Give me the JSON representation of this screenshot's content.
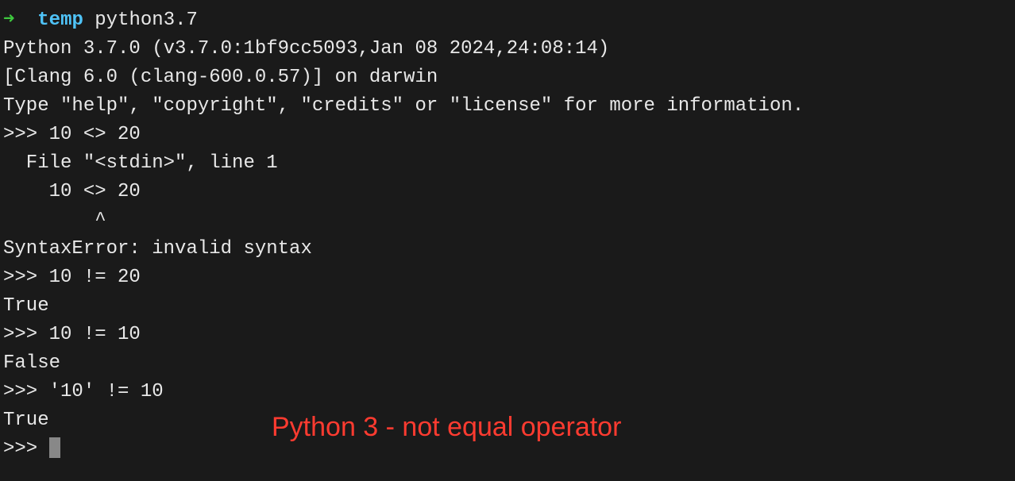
{
  "prompt": {
    "arrow": "➜  ",
    "dir": "temp",
    "command": " python3.7"
  },
  "lines": [
    "Python 3.7.0 (v3.7.0:1bf9cc5093,Jan 08 2024,24:08:14)",
    "[Clang 6.0 (clang-600.0.57)] on darwin",
    "Type \"help\", \"copyright\", \"credits\" or \"license\" for more information.",
    ">>> 10 <> 20",
    "  File \"<stdin>\", line 1",
    "    10 <> 20",
    "        ^",
    "SyntaxError: invalid syntax",
    ">>> 10 != 20",
    "True",
    ">>> 10 != 10",
    "False",
    ">>> '10' != 10",
    "True",
    ">>> "
  ],
  "caption": "Python 3 - not equal operator"
}
